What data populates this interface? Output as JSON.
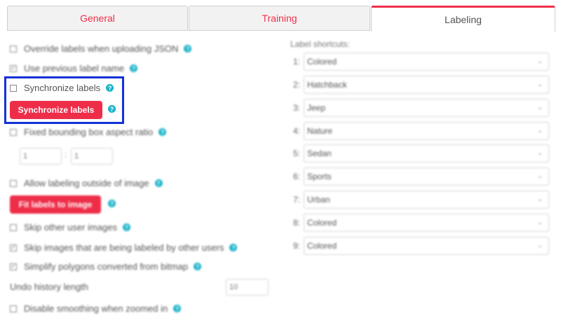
{
  "tabs": [
    {
      "label": "General",
      "active": false
    },
    {
      "label": "Training",
      "active": false
    },
    {
      "label": "Labeling",
      "active": true
    }
  ],
  "options": {
    "override_labels": {
      "label": "Override labels when uploading JSON",
      "checked": false
    },
    "use_previous_label": {
      "label": "Use previous label name",
      "checked": true
    },
    "synchronize_labels": {
      "label": "Synchronize labels",
      "checked": false
    },
    "synchronize_button": "Synchronize labels",
    "fixed_bbox_ratio": {
      "label": "Fixed bounding box aspect ratio",
      "checked": false
    },
    "ratio_a": "1",
    "ratio_sep": ":",
    "ratio_b": "1",
    "allow_outside": {
      "label": "Allow labeling outside of image",
      "checked": false
    },
    "fit_button": "Fit labels to image",
    "skip_other_user": {
      "label": "Skip other user images",
      "checked": false
    },
    "skip_being_labeled": {
      "label": "Skip images that are being labeled by other users",
      "checked": true
    },
    "simplify_polygons": {
      "label": "Simplify polygons converted from bitmap",
      "checked": true
    },
    "undo_history_label": "Undo history length",
    "undo_history_value": "10",
    "disable_smoothing": {
      "label": "Disable smoothing when zoomed in",
      "checked": false
    }
  },
  "shortcuts": {
    "title": "Label shortcuts:",
    "items": [
      {
        "num": "1:",
        "value": "Colored"
      },
      {
        "num": "2:",
        "value": "Hatchback"
      },
      {
        "num": "3:",
        "value": "Jeep"
      },
      {
        "num": "4:",
        "value": "Nature"
      },
      {
        "num": "5:",
        "value": "Sedan"
      },
      {
        "num": "6:",
        "value": "Sports"
      },
      {
        "num": "7:",
        "value": "Urban"
      },
      {
        "num": "8:",
        "value": "Colored"
      },
      {
        "num": "9:",
        "value": "Colored"
      }
    ]
  },
  "icons": {
    "help": "?",
    "check": "✓",
    "chevron": "⌄"
  },
  "colors": {
    "accent": "#ee2e49",
    "help": "#18b3c9",
    "highlight": "#1431d6"
  }
}
